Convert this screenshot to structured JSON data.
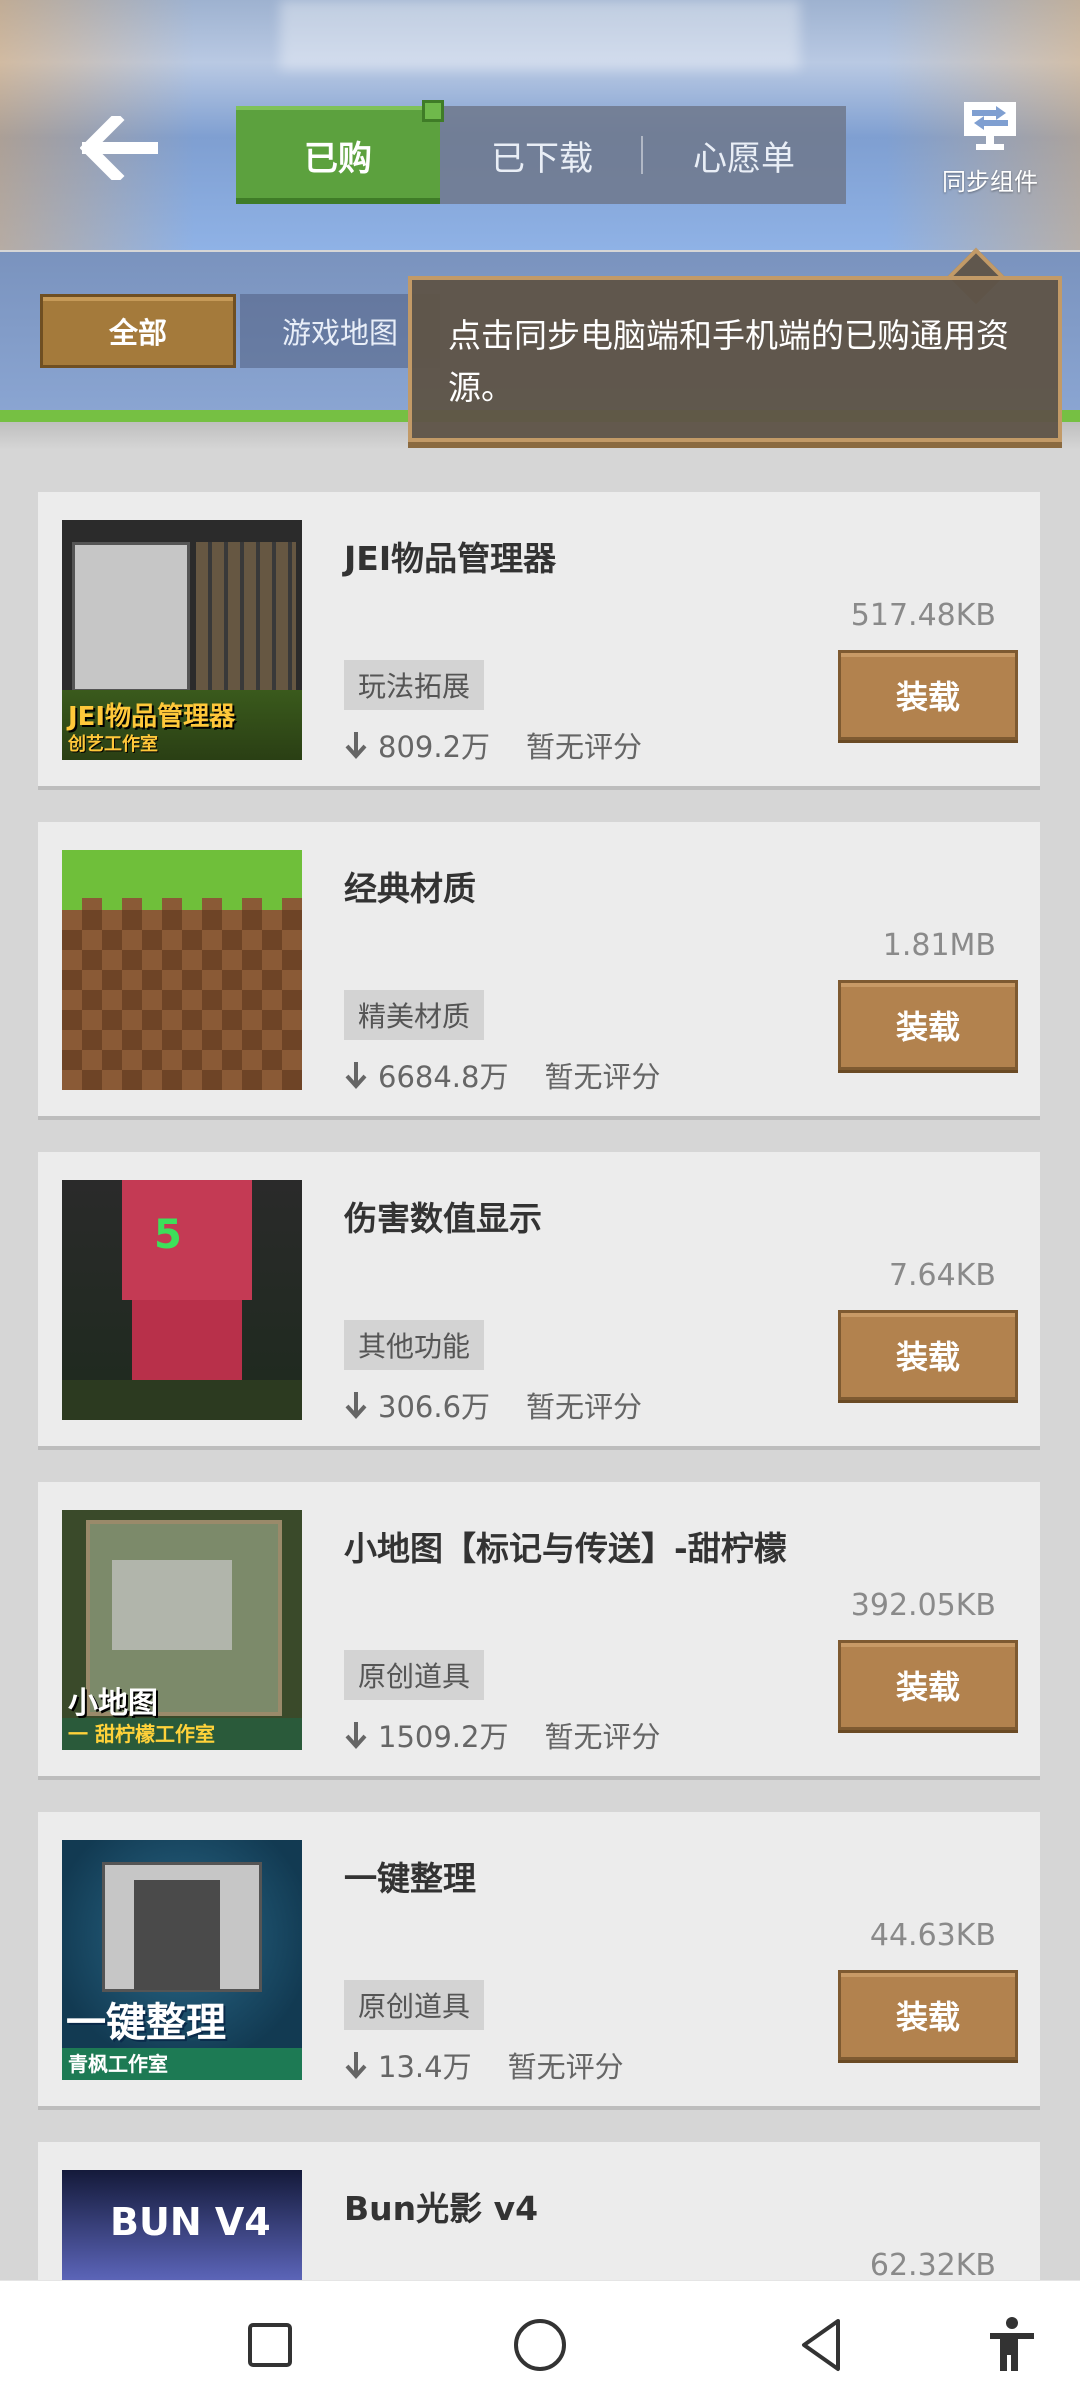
{
  "header": {
    "tabs": [
      "已购",
      "已下载",
      "心愿单"
    ],
    "sync_label": "同步组件"
  },
  "categories": [
    "全部",
    "游戏地图"
  ],
  "tooltip": "点击同步电脑端和手机端的已购通用资源。",
  "items": [
    {
      "title": "JEI物品管理器",
      "size": "517.48KB",
      "tag": "玩法拓展",
      "downloads": "809.2万",
      "rating": "暂无评分",
      "button": "装载",
      "thumb_text": [
        "JEI物品管理器",
        "创艺工作室"
      ]
    },
    {
      "title": "经典材质",
      "size": "1.81MB",
      "tag": "精美材质",
      "downloads": "6684.8万",
      "rating": "暂无评分",
      "button": "装载"
    },
    {
      "title": "伤害数值显示",
      "size": "7.64KB",
      "tag": "其他功能",
      "downloads": "306.6万",
      "rating": "暂无评分",
      "button": "装载",
      "thumb_text": [
        "5"
      ]
    },
    {
      "title": "小地图【标记与传送】-甜柠檬",
      "size": "392.05KB",
      "tag": "原创道具",
      "downloads": "1509.2万",
      "rating": "暂无评分",
      "button": "装载",
      "thumb_text": [
        "小地图",
        "一 甜柠檬工作室"
      ]
    },
    {
      "title": "一键整理",
      "size": "44.63KB",
      "tag": "原创道具",
      "downloads": "13.4万",
      "rating": "暂无评分",
      "button": "装载",
      "thumb_text": [
        "一键整理",
        "青枫工作室"
      ]
    },
    {
      "title": "Bun光影 v4",
      "size": "62.32KB",
      "thumb_text": [
        "BUN V4"
      ]
    }
  ],
  "colors": {
    "active_tab": "#5ca13e",
    "load_button": "#b2824e",
    "tooltip_bg": "#5f5448",
    "tooltip_border": "#c29a67"
  },
  "icons": {
    "back": "arrow-left-icon",
    "sync": "sync-computer-icon",
    "download": "download-arrow-icon",
    "nav": [
      "square-recent-icon",
      "circle-home-icon",
      "triangle-back-icon",
      "accessibility-icon"
    ]
  }
}
